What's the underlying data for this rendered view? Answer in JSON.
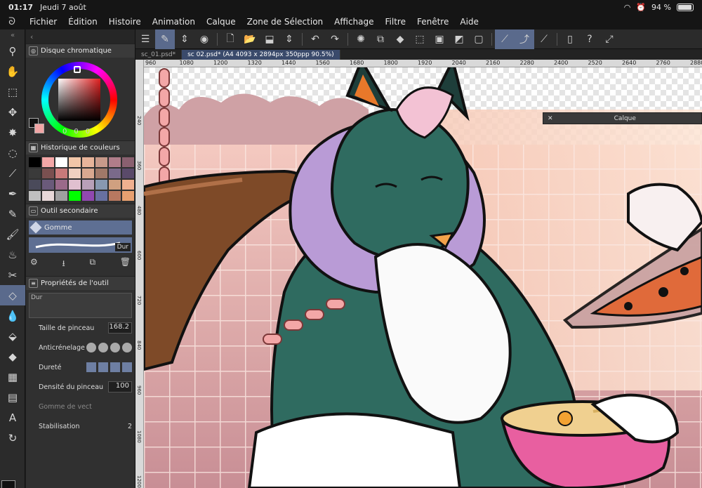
{
  "status": {
    "time": "01:17",
    "date": "Jeudi 7 août",
    "battery": "94 %"
  },
  "menu": [
    "Fichier",
    "Édition",
    "Histoire",
    "Animation",
    "Calque",
    "Zone de Sélection",
    "Affichage",
    "Filtre",
    "Fenêtre",
    "Aide"
  ],
  "panels": {
    "color_wheel_title": "Disque chromatique",
    "rgb_values": [
      "0",
      "0",
      "0"
    ],
    "history_title": "Historique de couleurs",
    "subtool_title": "Outil secondaire",
    "subtool_selected": "Gomme",
    "stroke_tag": "Dur",
    "tool_props_title": "Propriétés de l'outil",
    "brush_preview_tag": "Dur",
    "brush_size_label": "Taille de pinceau",
    "brush_size_value": "168.2",
    "antialias_label": "Anticrénelage",
    "hardness_label": "Dureté",
    "density_label": "Densité du pinceau",
    "density_value": "100",
    "vector_eraser_label": "Gomme de vect",
    "stabilization_label": "Stabilisation",
    "stabilization_value": "2"
  },
  "history_colors": [
    "#000000",
    "#f4a7a7",
    "#ffffff",
    "#f2c6a8",
    "#e8b49a",
    "#c89a8a",
    "#b07d8a",
    "#8a6070",
    "#3a3a3a",
    "#7a5050",
    "#c87a7a",
    "#f0d0c0",
    "#d8a890",
    "#a07868",
    "#7a6a8a",
    "#5a4a6a",
    "#4a4a5a",
    "#6a5a7a",
    "#9a6a8a",
    "#e0c0d0",
    "#b8a0b8",
    "#8898b0",
    "#d0a080",
    "#f0b090",
    "#c0c0c0",
    "#e8d8d8",
    "#a0a0a0",
    "#00ff00",
    "#9048b0",
    "#6870a0",
    "#b87860",
    "#e8a070"
  ],
  "tabs": [
    {
      "label": "sc_01.psd*"
    },
    {
      "label": "sc 02.psd* (A4 4093 x 2894px 350ppp 90.5%)"
    }
  ],
  "ruler_h": [
    "960",
    "1080",
    "1200",
    "1320",
    "1440",
    "1560",
    "1680",
    "1800",
    "1920",
    "2040",
    "2160",
    "2280",
    "2400",
    "2520",
    "2640",
    "2760",
    "2880"
  ],
  "ruler_v": [
    "240",
    "360",
    "480",
    "600",
    "720",
    "840",
    "960",
    "1080",
    "1200"
  ],
  "layer_panel_title": "Calque"
}
